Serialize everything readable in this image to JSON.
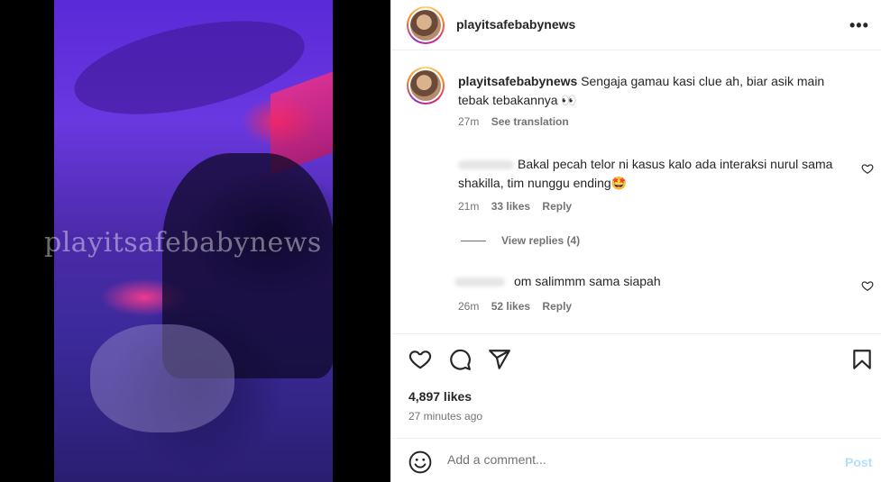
{
  "media": {
    "watermark": "playitsafebabynews"
  },
  "post": {
    "username": "playitsafebabynews",
    "more_label": "•••"
  },
  "caption": {
    "username": "playitsafebabynews",
    "text": "Sengaja gamau kasi clue ah, biar asik main tebak tebakannya 👀",
    "time": "27m",
    "translate_label": "See translation"
  },
  "comments": [
    {
      "text": "Bakal pecah telor ni kasus kalo ada interaksi nurul sama shakilla, tim nunggu ending🤩",
      "time": "21m",
      "likes": "33 likes",
      "reply_label": "Reply"
    },
    {
      "text": "om salimmm sama siapah",
      "time": "26m",
      "likes": "52 likes",
      "reply_label": "Reply"
    }
  ],
  "view_replies": "View replies (4)",
  "actions": {
    "icons": [
      "heart-icon",
      "comment-icon",
      "share-icon",
      "bookmark-icon"
    ],
    "likes": "4,897 likes",
    "time": "27 minutes ago"
  },
  "add_comment": {
    "placeholder": "Add a comment...",
    "post_label": "Post"
  },
  "colors": {
    "text": "#262626",
    "secondary": "#737373",
    "post_disabled": "#b2dffc"
  }
}
